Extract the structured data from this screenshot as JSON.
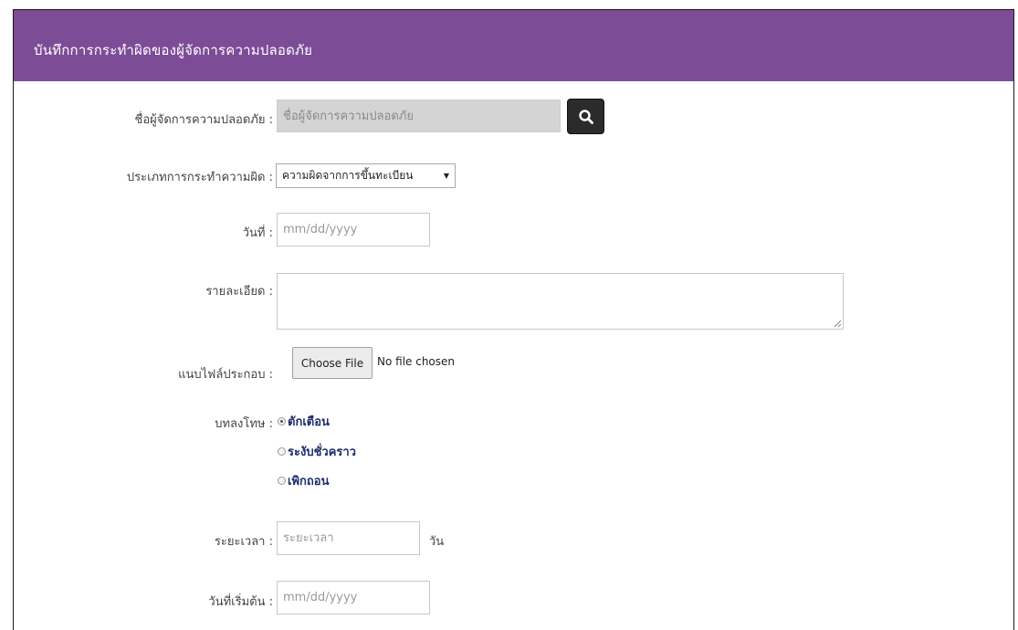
{
  "header": {
    "title": "บันทึกการกระทำผิดของผู้จัดการความปลอดภัย"
  },
  "form": {
    "manager": {
      "label": "ชื่อผู้จัดการความปลอดภัย :",
      "placeholder": "ชื่อผู้จัดการความปลอดภัย",
      "search_icon": "search-icon"
    },
    "offense_type": {
      "label": "ประเภทการกระทำความผิด :",
      "selected": "ความผิดจากการขึ้นทะเบียน",
      "arrow": "▼"
    },
    "date": {
      "label": "วันที่ :",
      "placeholder": "mm/dd/yyyy"
    },
    "details": {
      "label": "รายละเอียด :"
    },
    "attachment": {
      "label": "แนบไฟล์ประกอบ :",
      "button": "Choose File",
      "status": "No file chosen"
    },
    "penalty": {
      "label": "บทลงโทษ :",
      "options": [
        {
          "label": "ตักเตือน",
          "checked": true
        },
        {
          "label": "ระงับชั่วคราว",
          "checked": false
        },
        {
          "label": "เพิกถอน",
          "checked": false
        }
      ]
    },
    "duration": {
      "label": "ระยะเวลา :",
      "placeholder": "ระยะเวลา",
      "unit": "วัน"
    },
    "start_date": {
      "label": "วันที่เริ่มต้น :",
      "placeholder": "mm/dd/yyyy"
    }
  },
  "colors": {
    "header_bg": "#7d4c97",
    "search_button_bg": "#2b2b2b",
    "radio_label": "#1f2f6b"
  }
}
